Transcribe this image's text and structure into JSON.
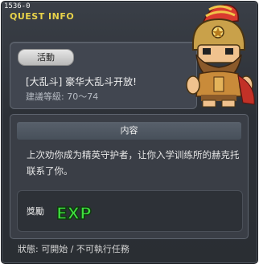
{
  "window": {
    "id_code": "1536-0",
    "title": "QUEST INFO"
  },
  "quest": {
    "category_tag": "活動",
    "name": "[大乱斗] 豪华大乱斗开放!",
    "level_text": "建議等級: 70～74"
  },
  "content": {
    "header": "内容",
    "description": "上次劝你成为精英守护者，让你入学训练所的赫克托联系了你。"
  },
  "reward": {
    "label": "獎勵",
    "icon": "exp-icon",
    "icon_text": "EXP"
  },
  "status_text": "狀態: 可開始 / 不可執行任務",
  "colors": {
    "title_accent": "#e8d34a",
    "exp_green": "#3fe03f",
    "window_bg": "#2c3036"
  }
}
